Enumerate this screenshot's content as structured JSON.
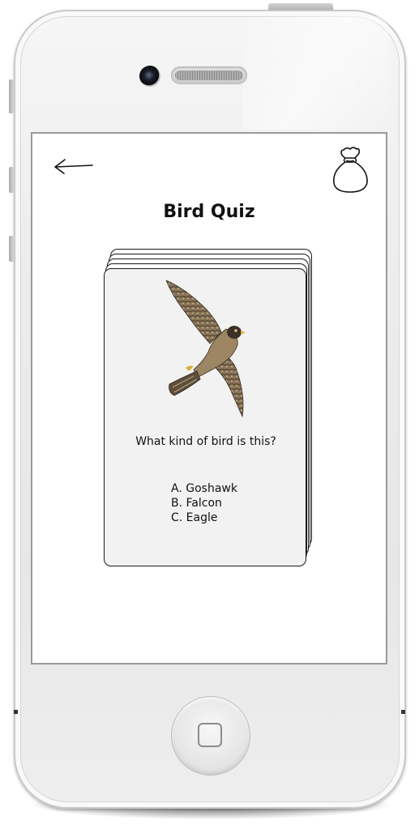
{
  "screen": {
    "title": "Bird Quiz",
    "back_icon": "back-arrow-icon",
    "bag_icon": "money-bag-icon"
  },
  "card": {
    "image": "falcon-in-flight",
    "question": "What kind of bird is this?",
    "answers": [
      "A. Goshawk",
      "B. Falcon",
      "C. Eagle"
    ]
  },
  "colors": {
    "card_background": "#f2f2f2",
    "screen_background": "#ffffff",
    "device_body": "#ececec"
  }
}
